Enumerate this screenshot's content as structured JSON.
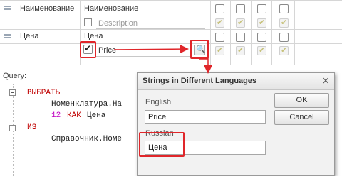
{
  "grid": {
    "rows": [
      {
        "field_name": "Наименование",
        "presentation": "Наименование",
        "sub_value": "Description"
      },
      {
        "field_name": "Цена",
        "presentation": "Цена",
        "sub_value": "Price"
      }
    ],
    "checkmark_glyph": "✔",
    "search_glyph": "🔍"
  },
  "query": {
    "label": "Query:",
    "lines": [
      {
        "kw": "ВЫБРАТЬ"
      },
      {
        "text": "Номенклатура.На"
      },
      {
        "num": "12",
        "kw": "КАК",
        "text": "Цена"
      },
      {
        "kw": "ИЗ"
      },
      {
        "text": "Справочник.Номе"
      }
    ]
  },
  "dialog": {
    "title": "Strings in Different Languages",
    "close_glyph": "×",
    "english_label": "English",
    "english_value": "Price",
    "russian_label": "Russian",
    "russian_value": "Цена",
    "ok_label": "OK",
    "cancel_label": "Cancel"
  },
  "colors": {
    "highlight": "#e0262a",
    "keyword": "#c00000",
    "number": "#c000c0"
  }
}
